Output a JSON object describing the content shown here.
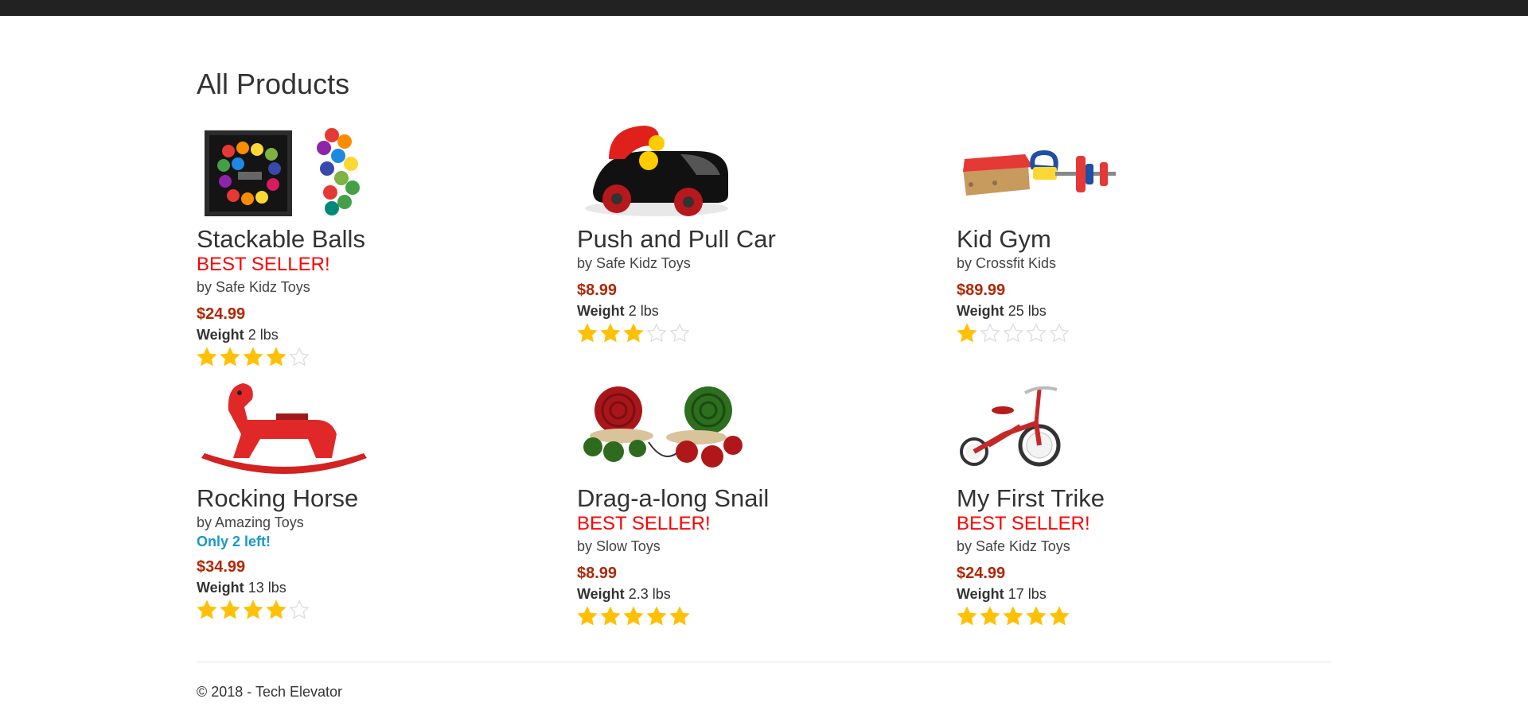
{
  "page": {
    "title": "All Products"
  },
  "products": [
    {
      "name": "Stackable Balls",
      "badge": "BEST SELLER!",
      "maker": "by Safe Kidz Toys",
      "stock": "",
      "price": "$24.99",
      "weight_label": "Weight",
      "weight_value": "2 lbs",
      "rating": 4,
      "image_icon": "stackable-balls-image"
    },
    {
      "name": "Push and Pull Car",
      "badge": "",
      "maker": "by Safe Kidz Toys",
      "stock": "",
      "price": "$8.99",
      "weight_label": "Weight",
      "weight_value": "2 lbs",
      "rating": 3,
      "image_icon": "toy-car-image"
    },
    {
      "name": "Kid Gym",
      "badge": "",
      "maker": "by Crossfit Kids",
      "stock": "",
      "price": "$89.99",
      "weight_label": "Weight",
      "weight_value": "25 lbs",
      "rating": 1,
      "image_icon": "kid-gym-image"
    },
    {
      "name": "Rocking Horse",
      "badge": "",
      "maker": "by Amazing Toys",
      "stock": "Only 2 left!",
      "price": "$34.99",
      "weight_label": "Weight",
      "weight_value": "13 lbs",
      "rating": 4,
      "image_icon": "rocking-horse-image"
    },
    {
      "name": "Drag-a-long Snail",
      "badge": "BEST SELLER!",
      "maker": "by Slow Toys",
      "stock": "",
      "price": "$8.99",
      "weight_label": "Weight",
      "weight_value": "2.3 lbs",
      "rating": 5,
      "image_icon": "snail-toy-image"
    },
    {
      "name": "My First Trike",
      "badge": "BEST SELLER!",
      "maker": "by Safe Kidz Toys",
      "stock": "",
      "price": "$24.99",
      "weight_label": "Weight",
      "weight_value": "17 lbs",
      "rating": 5,
      "image_icon": "tricycle-image"
    }
  ],
  "rating_max": 5,
  "colors": {
    "star_filled": "#ffc107",
    "star_empty": "#dddddd",
    "best_seller": "#ff0000",
    "price": "#b12704",
    "stock": "#1a98c9",
    "topbar": "#222222"
  },
  "footer": {
    "text": "© 2018 - Tech Elevator"
  }
}
